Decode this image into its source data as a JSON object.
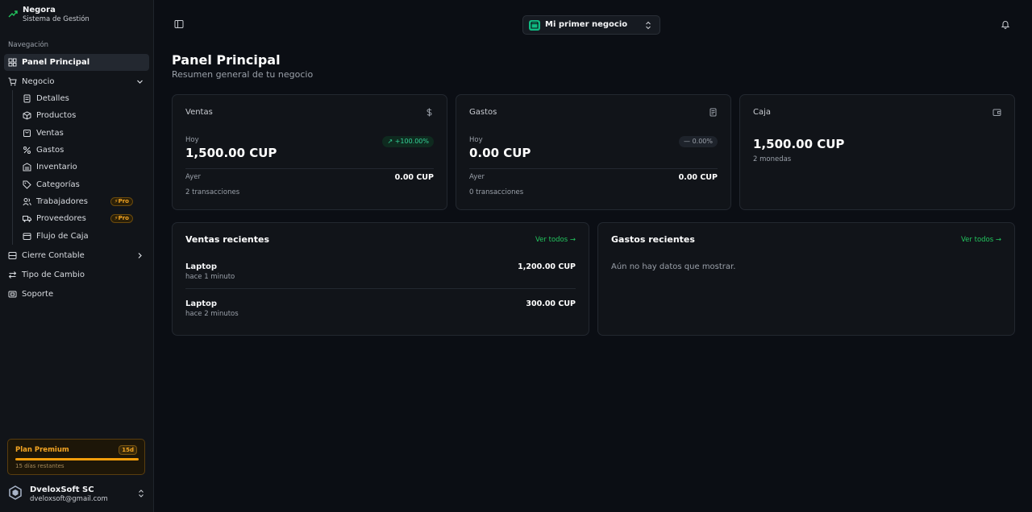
{
  "brand": {
    "name": "Negora",
    "subtitle": "Sistema de Gestión"
  },
  "sidebar": {
    "section_title": "Navegación",
    "items": [
      {
        "label": "Panel Principal",
        "icon": "grid-icon",
        "active": true
      },
      {
        "label": "Negocio",
        "icon": "cart-icon",
        "expanded": true
      },
      {
        "label": "Detalles",
        "icon": "document-icon"
      },
      {
        "label": "Productos",
        "icon": "box-icon"
      },
      {
        "label": "Ventas",
        "icon": "shopping-bag-icon"
      },
      {
        "label": "Gastos",
        "icon": "percent-icon"
      },
      {
        "label": "Inventario",
        "icon": "warehouse-icon"
      },
      {
        "label": "Categorías",
        "icon": "tag-icon"
      },
      {
        "label": "Trabajadores",
        "icon": "users-icon",
        "badge": "Pro"
      },
      {
        "label": "Proveedores",
        "icon": "truck-icon",
        "badge": "Pro"
      },
      {
        "label": "Flujo de Caja",
        "icon": "wallet-icon"
      },
      {
        "label": "Cierre Contable",
        "icon": "ledger-icon"
      },
      {
        "label": "Tipo de Cambio",
        "icon": "exchange-icon"
      },
      {
        "label": "Soporte",
        "icon": "support-icon"
      }
    ],
    "plan": {
      "title": "Plan Premium",
      "badge": "15d",
      "subtitle": "15 días restantes",
      "progress": 1.0
    },
    "user": {
      "name": "DveloxSoft SC",
      "email": "dveloxsoft@gmail.com"
    }
  },
  "header": {
    "business_selector": "Mi primer negocio"
  },
  "page": {
    "title": "Panel Principal",
    "subtitle": "Resumen general de tu negocio"
  },
  "cards": {
    "ventas": {
      "title": "Ventas",
      "today_label": "Hoy",
      "today_value": "1,500.00 CUP",
      "change": "+100.00%",
      "yesterday_label": "Ayer",
      "yesterday_value": "0.00 CUP",
      "transactions": "2 transacciones"
    },
    "gastos": {
      "title": "Gastos",
      "today_label": "Hoy",
      "today_value": "0.00 CUP",
      "change": "0.00%",
      "yesterday_label": "Ayer",
      "yesterday_value": "0.00 CUP",
      "transactions": "0 transacciones"
    },
    "caja": {
      "title": "Caja",
      "value": "1,500.00 CUP",
      "sub": "2 monedas"
    }
  },
  "recent_sales": {
    "title": "Ventas recientes",
    "see_all": "Ver todos",
    "rows": [
      {
        "name": "Laptop",
        "time": "hace 1 minuto",
        "amount": "1,200.00 CUP"
      },
      {
        "name": "Laptop",
        "time": "hace 2 minutos",
        "amount": "300.00 CUP"
      }
    ]
  },
  "recent_expenses": {
    "title": "Gastos recientes",
    "see_all": "Ver todos",
    "empty": "Aún no hay datos que mostrar."
  },
  "colors": {
    "accent": "#22c55e",
    "brand": "#10b981",
    "pro": "#f5a623",
    "background": "#0b0e14",
    "card": "#111419"
  }
}
